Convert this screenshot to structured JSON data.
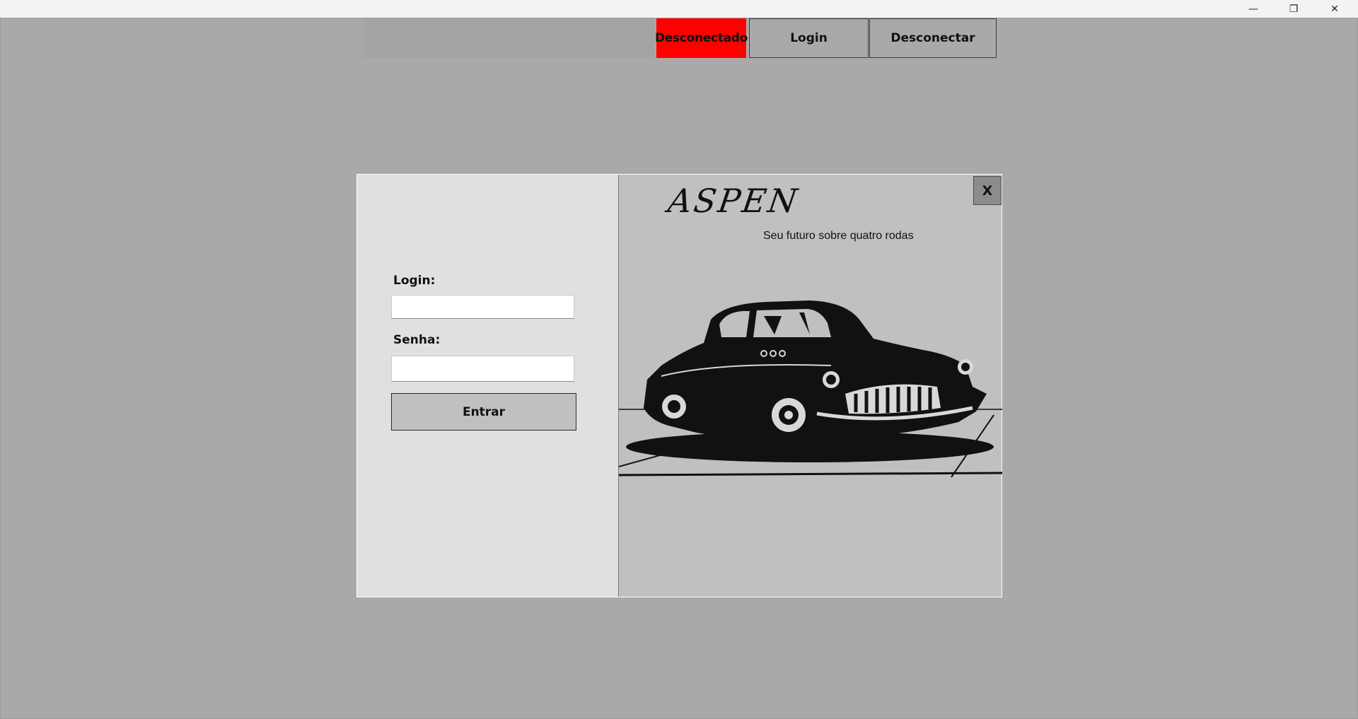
{
  "window_controls": {
    "minimize_icon": "minimize-icon",
    "restore_icon": "restore-icon",
    "close_icon": "close-icon"
  },
  "topbar": {
    "status": "Desconectado",
    "status_color": "#ff0000",
    "login_button": "Login",
    "disconnect_button": "Desconectar"
  },
  "dialog": {
    "login_label": "Login:",
    "login_value": "",
    "password_label": "Senha:",
    "password_value": "",
    "submit_button": "Entrar",
    "close_button": "X",
    "brand_name": "ASPEN",
    "tagline": "Seu futuro sobre quatro rodas",
    "illustration": "vintage-car-illustration"
  }
}
